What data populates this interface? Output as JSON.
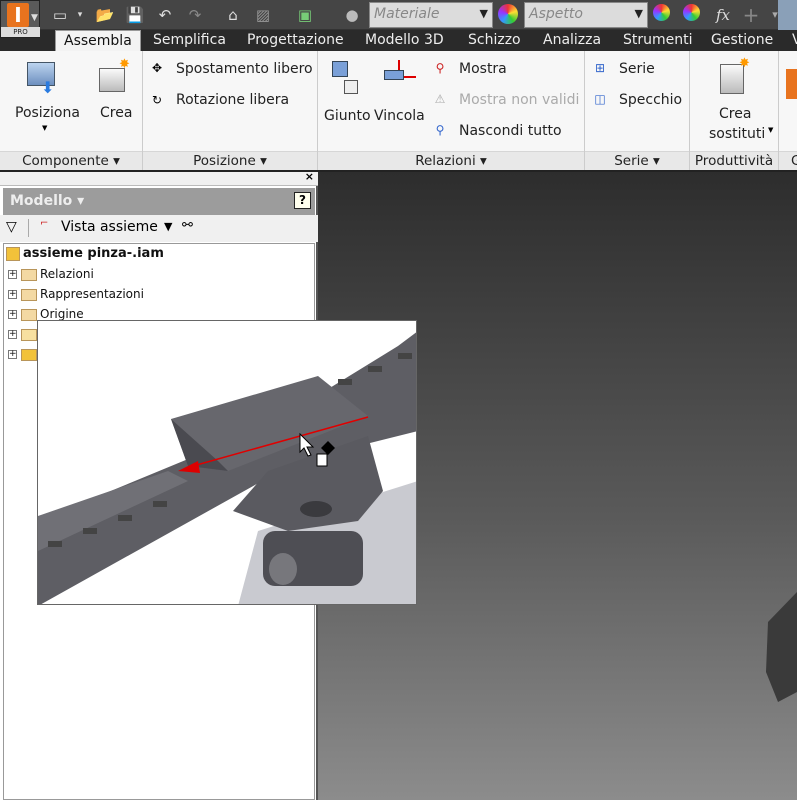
{
  "app": {
    "badge": "PRO",
    "logo_letter": "I"
  },
  "quick_access": {
    "material_placeholder": "Materiale",
    "appearance_placeholder": "Aspetto",
    "fx_label": "fx",
    "icons": [
      "new-icon",
      "open-icon",
      "save-icon",
      "undo-icon",
      "redo-icon",
      "home-icon",
      "update-icon",
      "select-icon",
      "material-sphere-icon",
      "color-wheel-icon",
      "appearance-adjust-icon",
      "clear-appearance-icon",
      "plus-icon"
    ]
  },
  "tabs": [
    {
      "label": "Assembla",
      "active": true
    },
    {
      "label": "Semplifica"
    },
    {
      "label": "Progettazione"
    },
    {
      "label": "Modello 3D"
    },
    {
      "label": "Schizzo"
    },
    {
      "label": "Analizza"
    },
    {
      "label": "Strumenti"
    },
    {
      "label": "Gestione"
    },
    {
      "label": "V"
    }
  ],
  "ribbon": {
    "componente": {
      "label": "Componente",
      "posiziona": "Posiziona",
      "crea": "Crea"
    },
    "posizione": {
      "label": "Posizione",
      "spostamento": "Spostamento libero",
      "rotazione": "Rotazione libera"
    },
    "relazioni": {
      "label": "Relazioni",
      "giunto": "Giunto",
      "vincola": "Vincola",
      "mostra": "Mostra",
      "mostra_non_validi": "Mostra non validi",
      "nascondi_tutto": "Nascondi tutto"
    },
    "serie": {
      "label": "Serie",
      "serie": "Serie",
      "specchio": "Specchio"
    },
    "produttivita": {
      "label": "Produttività",
      "crea_sostituti_1": "Crea",
      "crea_sostituti_2": "sostituti"
    },
    "next_label": "G"
  },
  "browser": {
    "title": "Modello",
    "view": "Vista assieme",
    "root": "assieme pinza-.iam",
    "items": [
      "Relazioni",
      "Rappresentazioni",
      "Origine"
    ]
  },
  "colors": {
    "accent": "#e8731e",
    "constraint_red": "#e00000"
  }
}
